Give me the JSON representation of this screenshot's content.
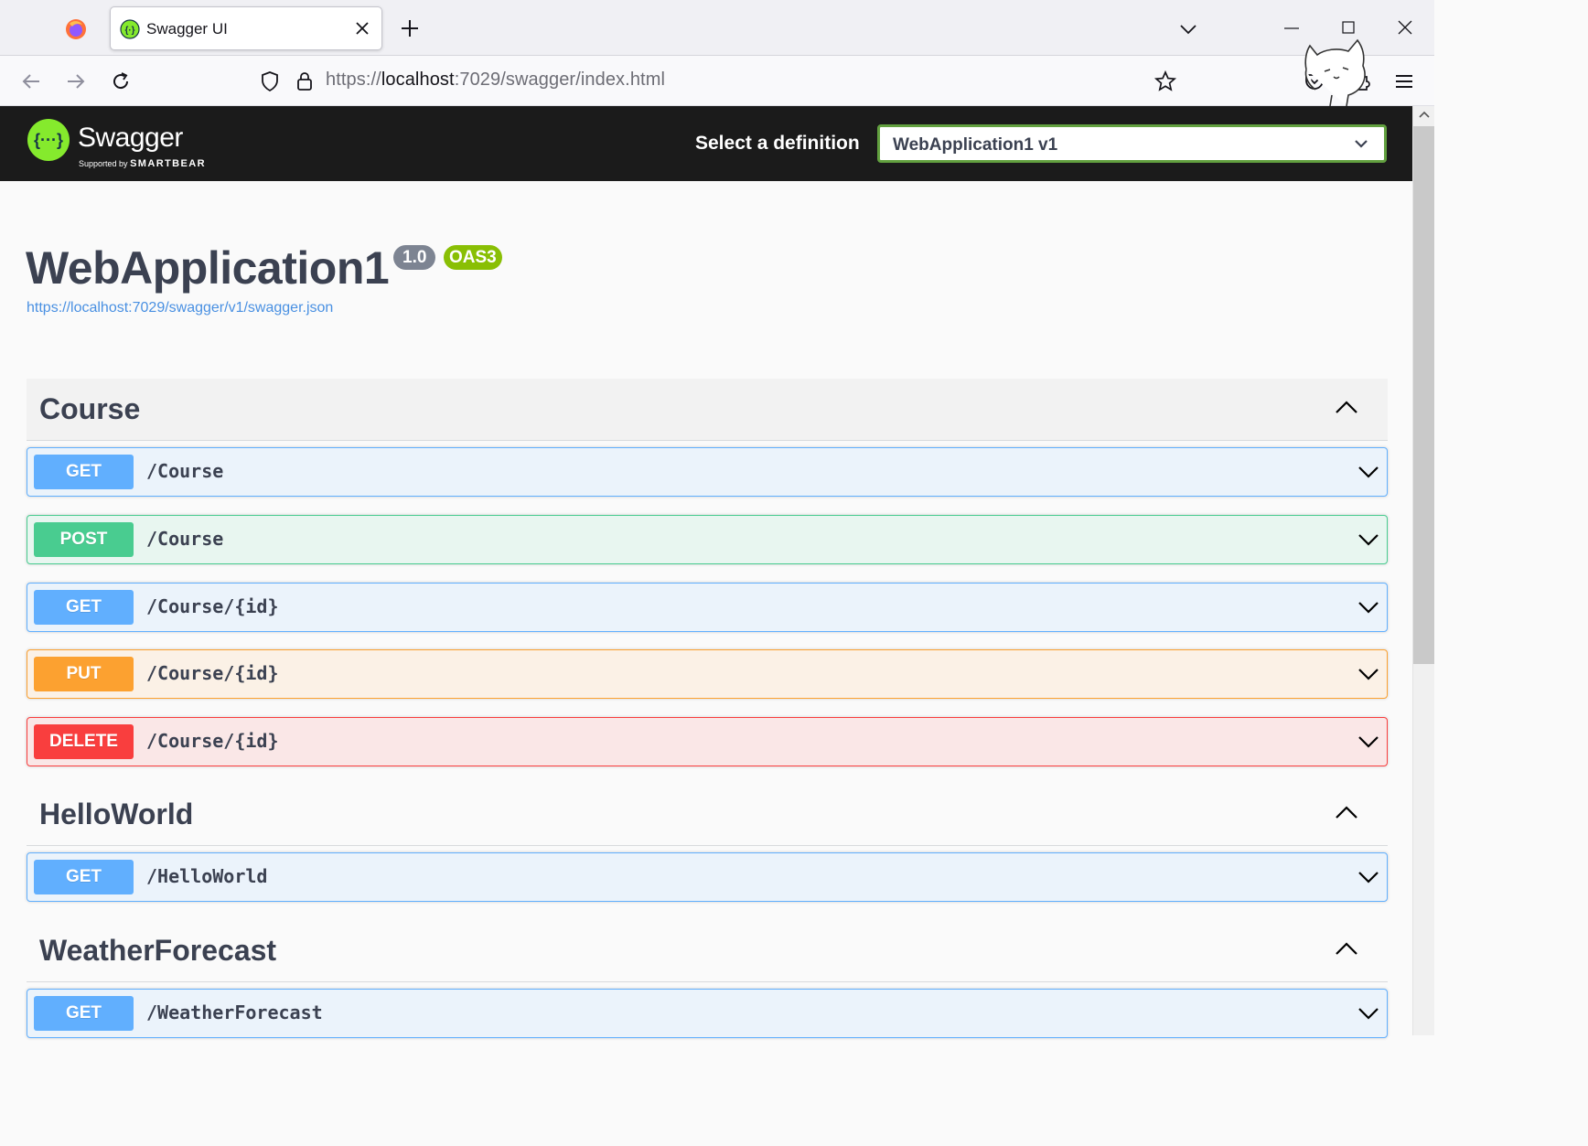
{
  "browser": {
    "tab_title": "Swagger UI",
    "url_scheme": "https://",
    "url_host": "localhost",
    "url_rest": ":7029/swagger/index.html"
  },
  "topbar": {
    "brand": "Swagger",
    "brand_sub_prefix": "Supported by",
    "brand_sub_company": "SMARTBEAR",
    "definition_label": "Select a definition",
    "definition_selected": "WebApplication1 v1"
  },
  "info": {
    "title": "WebApplication1",
    "version_badge": "1.0",
    "oas_badge": "OAS3",
    "spec_url": "https://localhost:7029/swagger/v1/swagger.json"
  },
  "tags": [
    {
      "name": "Course",
      "operations": [
        {
          "method": "GET",
          "path": "/Course"
        },
        {
          "method": "POST",
          "path": "/Course"
        },
        {
          "method": "GET",
          "path": "/Course/{id}"
        },
        {
          "method": "PUT",
          "path": "/Course/{id}"
        },
        {
          "method": "DELETE",
          "path": "/Course/{id}"
        }
      ]
    },
    {
      "name": "HelloWorld",
      "operations": [
        {
          "method": "GET",
          "path": "/HelloWorld"
        }
      ]
    },
    {
      "name": "WeatherForecast",
      "operations": [
        {
          "method": "GET",
          "path": "/WeatherForecast"
        }
      ]
    }
  ],
  "colors": {
    "get": "#61affe",
    "post": "#49cc90",
    "put": "#fca130",
    "delete": "#f93e3e",
    "swagger_green": "#85ea2d",
    "topbar_bg": "#1b1b1b"
  },
  "icons": {
    "browser_logo": "firefox-logo-icon",
    "back": "back-arrow-icon",
    "forward": "forward-arrow-icon",
    "reload": "reload-icon",
    "tracking": "shield-icon",
    "lock": "lock-icon",
    "bookmark": "star-icon",
    "pocket": "pocket-icon",
    "extensions": "puzzle-icon",
    "menu": "hamburger-menu-icon",
    "expand_tag": "chevron-up-icon",
    "expand_op": "chevron-down-icon"
  }
}
